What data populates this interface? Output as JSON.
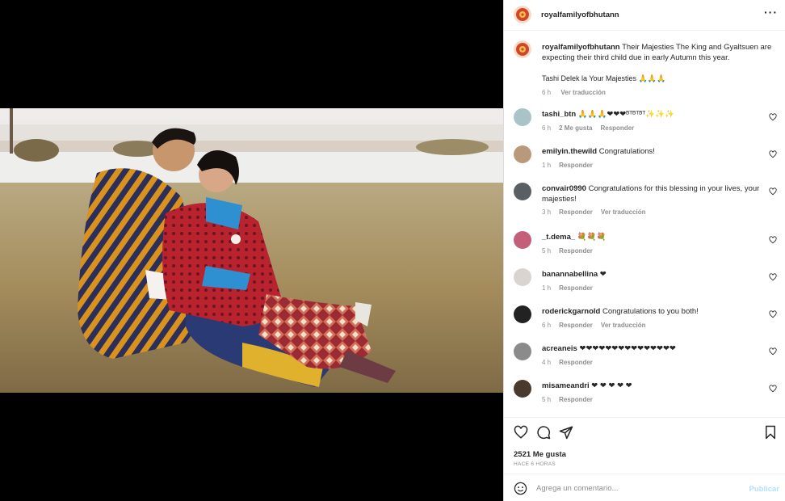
{
  "post": {
    "username": "royalfamilyofbhutann",
    "more_icon": "more-horizontal-icon",
    "caption_user": "royalfamilyofbhutann",
    "caption_text": "Their Majesties The King and Gyaltsuen are expecting their third child due in early Autumn this year.",
    "caption_line2": "Tashi Delek la Your Majesties 🙏🙏🙏",
    "caption_time": "6 h",
    "caption_translate": "Ver traducción"
  },
  "comments": [
    {
      "user": "tashi_btn",
      "text": "🙏🙏🙏❤❤❤ᴮᵀᴮᵀᴮᵀ✨✨✨",
      "time": "6 h",
      "likes": "2 Me gusta",
      "reply": "Responder",
      "translate": ""
    },
    {
      "user": "emilyin.thewild",
      "text": "Congratulations!",
      "time": "1 h",
      "likes": "",
      "reply": "Responder",
      "translate": ""
    },
    {
      "user": "convair0990",
      "text": "Congratulations for this blessing in your lives, your majesties!",
      "time": "3 h",
      "likes": "",
      "reply": "Responder",
      "translate": "Ver traducción"
    },
    {
      "user": "_t.dema_",
      "text": "💐💐💐",
      "time": "5 h",
      "likes": "",
      "reply": "Responder",
      "translate": ""
    },
    {
      "user": "banannabellina",
      "text": "❤",
      "time": "1 h",
      "likes": "",
      "reply": "Responder",
      "translate": ""
    },
    {
      "user": "roderickgarnold",
      "text": "Congratulations to you both!",
      "time": "6 h",
      "likes": "",
      "reply": "Responder",
      "translate": "Ver traducción"
    },
    {
      "user": "acreaneis",
      "text": "❤❤❤❤❤❤❤❤❤❤❤❤❤❤❤",
      "time": "4 h",
      "likes": "",
      "reply": "Responder",
      "translate": ""
    },
    {
      "user": "misameandri",
      "text": "❤ ❤ ❤ ❤ ❤",
      "time": "5 h",
      "likes": "",
      "reply": "Responder",
      "translate": ""
    }
  ],
  "actions": {
    "like_icon": "heart-icon",
    "comment_icon": "comment-icon",
    "share_icon": "share-icon",
    "save_icon": "bookmark-icon",
    "likes_count": "2521 Me gusta",
    "time_ago": "HACE 6 HORAS"
  },
  "composer": {
    "emoji_icon": "emoji-icon",
    "placeholder": "Agrega un comentario...",
    "publish_label": "Publicar"
  },
  "colors": {
    "accent_publish": "#b2dffc",
    "heart_red": "#ed4956",
    "muted": "#8e8e8e"
  }
}
